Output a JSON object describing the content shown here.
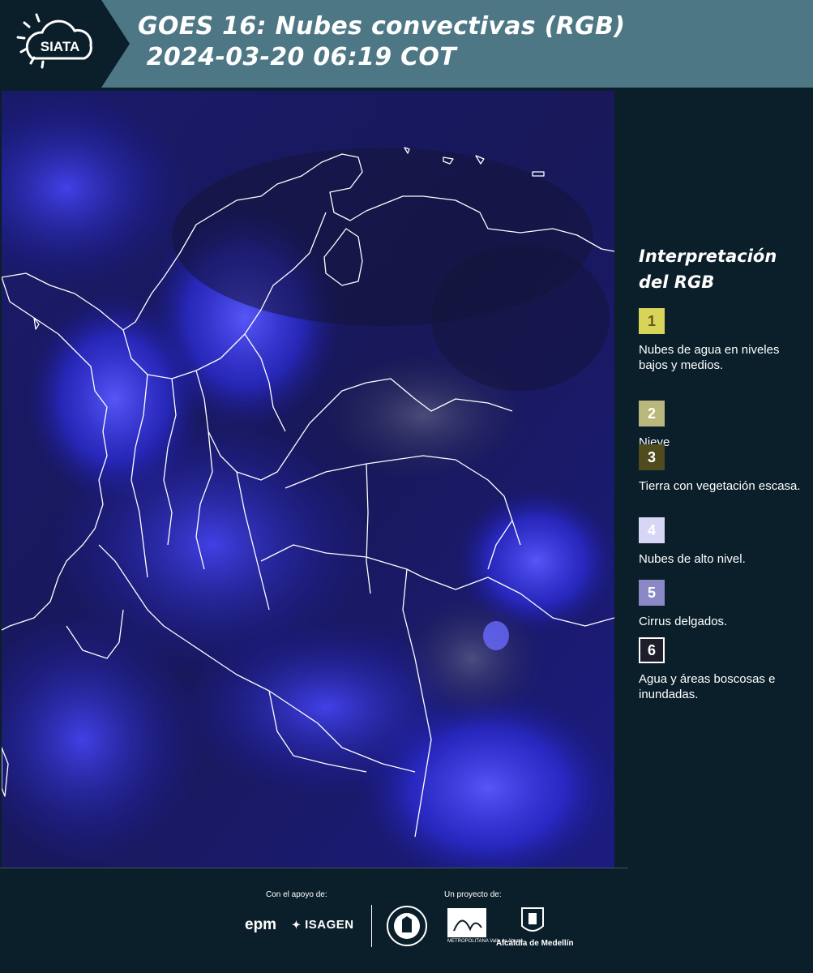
{
  "header": {
    "logo_text": "SIATA",
    "title_line1": "GOES 16: Nubes convectivas (RGB)",
    "title_line2": " 2024-03-20 06:19 COT"
  },
  "legend": {
    "title": "Interpretación del RGB",
    "items": [
      {
        "number": "1",
        "label": "Nubes de agua en niveles bajos y medios.",
        "color": "#d8d45a",
        "text_color": "#5b5a1f"
      },
      {
        "number": "2",
        "label": "Nieve",
        "color": "#b9b77c",
        "text_color": "#ffffff"
      },
      {
        "number": "3",
        "label": "Tierra con vegetación escasa.",
        "color": "#4f4b1d",
        "text_color": "#ffffff"
      },
      {
        "number": "4",
        "label": "Nubes de alto nivel.",
        "color": "#d6d6f6",
        "text_color": "#ffffff"
      },
      {
        "number": "5",
        "label": "Cirrus delgados.",
        "color": "#8b88c6",
        "text_color": "#ffffff"
      },
      {
        "number": "6",
        "label": "Agua y áreas boscosas e inundadas.",
        "color": "#1e1e2a",
        "text_color": "#ffffff"
      }
    ]
  },
  "footer": {
    "support_label": "Con el apoyo de:",
    "project_label": "Un proyecto de:",
    "sponsors": [
      "epm",
      "ISAGEN"
    ],
    "partners": [
      "Área Metropolitana Valle de Aburrá",
      "Alcaldía de Medellín"
    ],
    "partner_label_metro": "METROPOLITANA Valle de Aburrá",
    "partner_label_alcaldia": "Alcaldía de Medellín"
  },
  "colors": {
    "header_bg": "#4d7785",
    "panel_bg": "#0b1f2a",
    "map_dark": "#12124a",
    "map_cloud": "#3a3aff",
    "border_lines": "#ffffff"
  }
}
